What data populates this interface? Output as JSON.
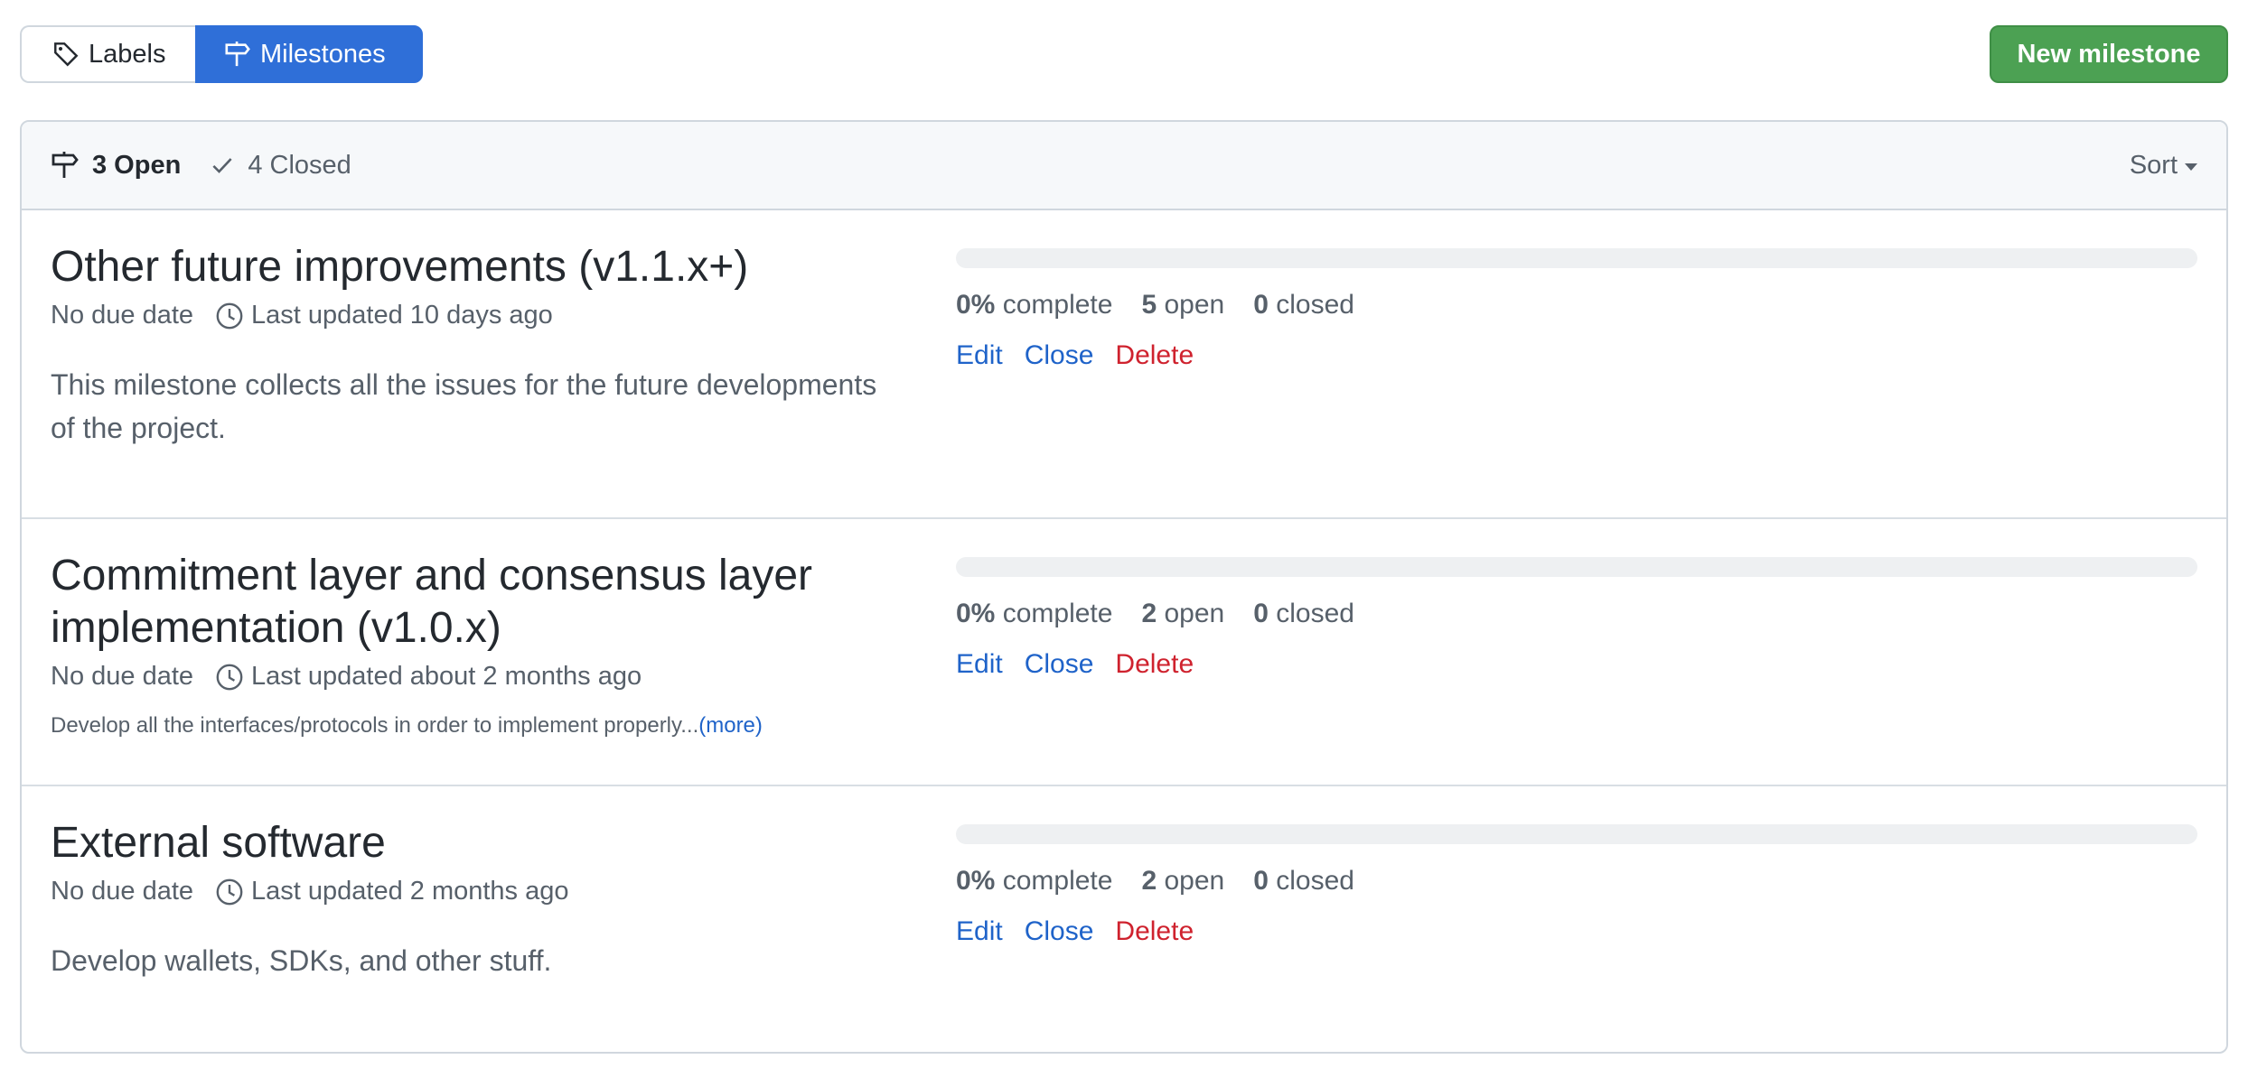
{
  "subnav": {
    "labels": "Labels",
    "milestones": "Milestones"
  },
  "new_milestone_button": "New milestone",
  "header": {
    "open_count": "3 Open",
    "closed_count": "4 Closed",
    "sort_label": "Sort"
  },
  "milestones": [
    {
      "title": "Other future improvements (v1.1.x+)",
      "due": "No due date",
      "updated": "Last updated 10 days ago",
      "description": "This milestone collects all the issues for the future developments of the project.",
      "progress": 0,
      "percent": "0%",
      "complete_label": "complete",
      "open": "5",
      "open_label": "open",
      "closed": "0",
      "closed_label": "closed"
    },
    {
      "title": "Commitment layer and consensus layer implementation (v1.0.x)",
      "due": "No due date",
      "updated": "Last updated about 2 months ago",
      "description": "Develop all the interfaces/protocols in order to implement properly...",
      "more": "(more)",
      "progress": 0,
      "percent": "0%",
      "complete_label": "complete",
      "open": "2",
      "open_label": "open",
      "closed": "0",
      "closed_label": "closed"
    },
    {
      "title": "External software",
      "due": "No due date",
      "updated": "Last updated 2 months ago",
      "description": "Develop wallets, SDKs, and other stuff.",
      "progress": 0,
      "percent": "0%",
      "complete_label": "complete",
      "open": "2",
      "open_label": "open",
      "closed": "0",
      "closed_label": "closed"
    }
  ],
  "actions": {
    "edit": "Edit",
    "close": "Close",
    "delete": "Delete"
  },
  "colors": {
    "primary_blue": "#2f6fd8",
    "green_button": "#4ca153",
    "link_blue": "#1f63c9",
    "danger_red": "#cf222e"
  }
}
